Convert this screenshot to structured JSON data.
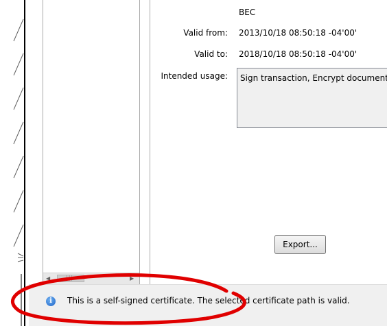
{
  "certificate": {
    "issuer_value": "BEC",
    "valid_from_label": "Valid from:",
    "valid_from_value": "2013/10/18 08:50:18 -04'00'",
    "valid_to_label": "Valid to:",
    "valid_to_value": "2018/10/18 08:50:18 -04'00'",
    "intended_usage_label": "Intended usage:",
    "intended_usage_value": "Sign transaction, Encrypt document"
  },
  "buttons": {
    "export_label": "Export..."
  },
  "status": {
    "icon": "info-icon",
    "message": "This is a self-signed certificate. The selected certificate path is valid."
  },
  "annotation": {
    "color": "#e00000"
  },
  "colors": {
    "panel_border": "#a9a9a9",
    "status_bg": "#f0f0f0",
    "usage_bg": "#f0f0f0"
  }
}
